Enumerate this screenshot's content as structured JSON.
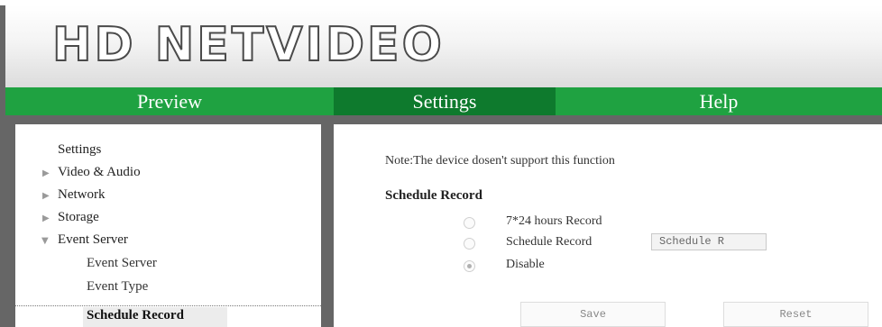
{
  "header": {
    "logo_text": "HD NETVIDEO"
  },
  "nav": {
    "tabs": [
      {
        "label": "Preview",
        "active": false
      },
      {
        "label": "Settings",
        "active": true
      },
      {
        "label": "Help",
        "active": false
      }
    ]
  },
  "sidebar": {
    "title": "Settings",
    "items": [
      {
        "label": "Video & Audio",
        "arrow": "collapsed"
      },
      {
        "label": "Network",
        "arrow": "collapsed"
      },
      {
        "label": "Storage",
        "arrow": "collapsed"
      },
      {
        "label": "Event Server",
        "arrow": "expanded"
      }
    ],
    "subitems": [
      {
        "label": "Event Server",
        "active": false
      },
      {
        "label": "Event Type",
        "active": false
      },
      {
        "label": "Schedule Record",
        "active": true
      }
    ]
  },
  "content": {
    "note": "Note:The device dosen't support this function",
    "section_title": "Schedule Record",
    "options": [
      {
        "label": "7*24 hours Record",
        "checked": false
      },
      {
        "label": "Schedule Record",
        "checked": false
      },
      {
        "label": "Disable",
        "checked": true
      }
    ],
    "schedule_button_label": "Schedule R",
    "save_label": "Save",
    "reset_label": "Reset"
  },
  "colors": {
    "nav_green": "#1fa241",
    "nav_active": "#0e7a2d",
    "frame_gray": "#666666"
  }
}
